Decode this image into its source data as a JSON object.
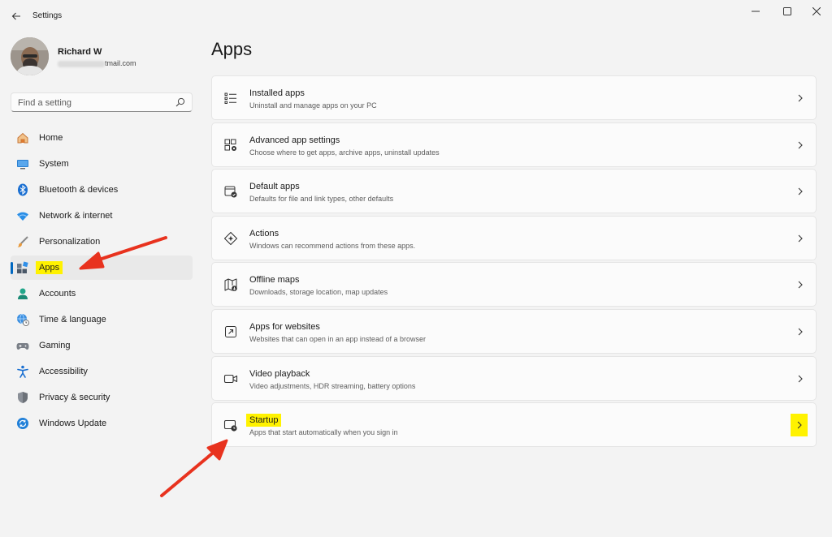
{
  "window": {
    "title": "Settings"
  },
  "profile": {
    "name": "Richard W",
    "email_suffix": "tmail.com"
  },
  "search": {
    "placeholder": "Find a setting"
  },
  "nav": {
    "items": [
      {
        "label": "Home",
        "icon": "home-icon"
      },
      {
        "label": "System",
        "icon": "system-icon"
      },
      {
        "label": "Bluetooth & devices",
        "icon": "bluetooth-icon"
      },
      {
        "label": "Network & internet",
        "icon": "wifi-icon"
      },
      {
        "label": "Personalization",
        "icon": "brush-icon"
      },
      {
        "label": "Apps",
        "icon": "apps-icon",
        "selected": true
      },
      {
        "label": "Accounts",
        "icon": "person-icon"
      },
      {
        "label": "Time & language",
        "icon": "globe-clock-icon"
      },
      {
        "label": "Gaming",
        "icon": "controller-icon"
      },
      {
        "label": "Accessibility",
        "icon": "accessibility-icon"
      },
      {
        "label": "Privacy & security",
        "icon": "shield-icon"
      },
      {
        "label": "Windows Update",
        "icon": "update-icon"
      }
    ]
  },
  "main": {
    "title": "Apps",
    "cards": [
      {
        "title": "Installed apps",
        "subtitle": "Uninstall and manage apps on your PC",
        "icon": "list-icon"
      },
      {
        "title": "Advanced app settings",
        "subtitle": "Choose where to get apps, archive apps, uninstall updates",
        "icon": "app-settings-icon"
      },
      {
        "title": "Default apps",
        "subtitle": "Defaults for file and link types, other defaults",
        "icon": "default-apps-icon"
      },
      {
        "title": "Actions",
        "subtitle": "Windows can recommend actions from these apps.",
        "icon": "actions-icon"
      },
      {
        "title": "Offline maps",
        "subtitle": "Downloads, storage location, map updates",
        "icon": "map-icon"
      },
      {
        "title": "Apps for websites",
        "subtitle": "Websites that can open in an app instead of a browser",
        "icon": "open-external-icon"
      },
      {
        "title": "Video playback",
        "subtitle": "Video adjustments, HDR streaming, battery options",
        "icon": "video-icon"
      },
      {
        "title": "Startup",
        "subtitle": "Apps that start automatically when you sign in",
        "icon": "startup-icon"
      }
    ]
  },
  "colors": {
    "accent": "#0067c0",
    "highlight": "#fff200",
    "annotation_arrow": "#e8321e"
  }
}
